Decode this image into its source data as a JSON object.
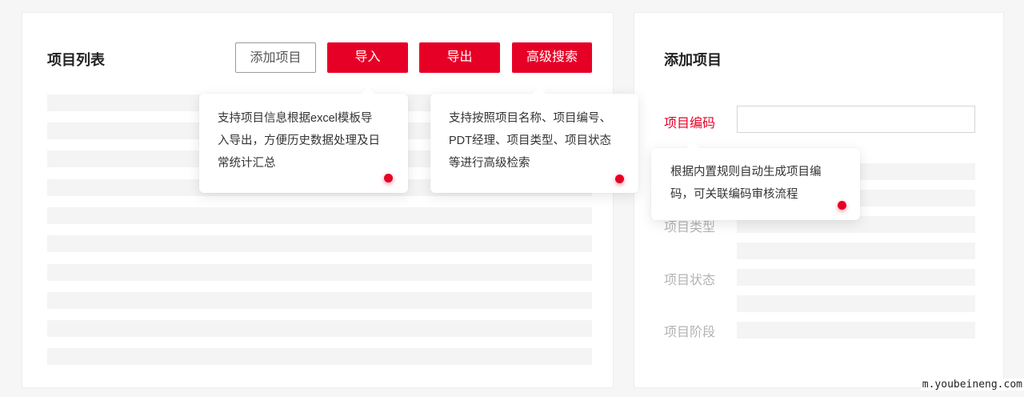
{
  "left_panel": {
    "title": "项目列表",
    "buttons": {
      "add": "添加项目",
      "import": "导入",
      "export": "导出",
      "advanced_search": "高级搜索"
    }
  },
  "tooltips": {
    "import_export": [
      "支持项目信息根据excel模板导",
      "入导出，方便历史数据处理及日",
      "常统计汇总"
    ],
    "advanced_search": [
      "支持按照项目名称、项目编号、",
      "PDT经理、项目类型、项目状态",
      "等进行高级检索"
    ],
    "project_code": [
      "根据内置规则自动生成项目编",
      "码，可关联编码审核流程"
    ]
  },
  "right_panel": {
    "title": "添加项目",
    "fields": {
      "project_code": "项目编码",
      "project_type": "项目类型",
      "project_status": "项目状态",
      "project_stage": "项目阶段"
    },
    "project_code_value": ""
  },
  "colors": {
    "accent": "#e60026",
    "placeholder_bar": "#f4f4f4"
  },
  "watermark": "m.youbeineng.com"
}
